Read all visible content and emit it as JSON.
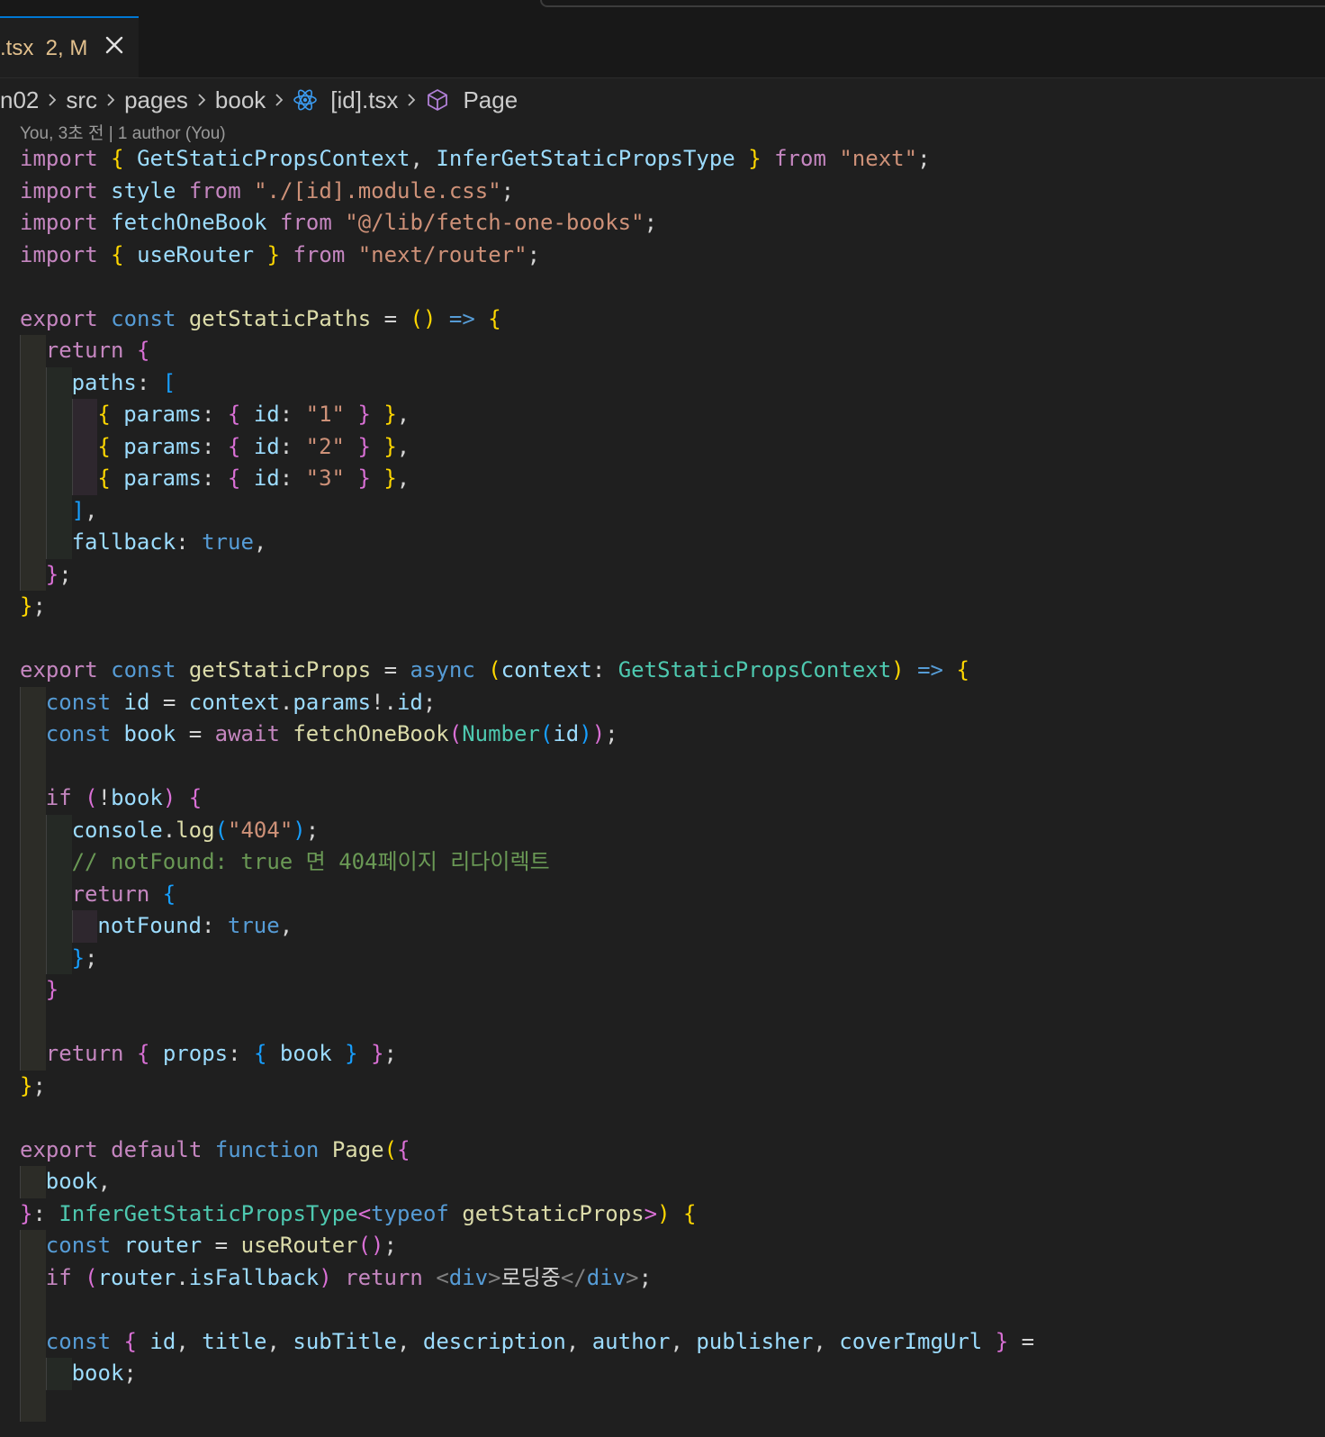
{
  "tab": {
    "label": ".tsx  2, M"
  },
  "breadcrumb": {
    "items": [
      "n02",
      "src",
      "pages",
      "book",
      "[id].tsx",
      "Page"
    ]
  },
  "blame": {
    "text": "You, 3초 전 | 1 author (You)"
  },
  "colors": {
    "keyword": "#c586c0",
    "string": "#ce9178",
    "storage": "#569cd6",
    "variable": "#9cdcfe",
    "function": "#dcdcaa",
    "type": "#4ec9b0",
    "comment": "#6a9955",
    "bracket1": "#ffd700",
    "bracket2": "#da70d6",
    "bracket3": "#179fff",
    "accent": "#0078d4"
  },
  "code": {
    "lines": [
      {
        "indent": 0,
        "tokens": [
          [
            "import",
            "k"
          ],
          [
            " ",
            "w"
          ],
          [
            "{",
            "y"
          ],
          [
            " ",
            "w"
          ],
          [
            "GetStaticPropsContext",
            "v"
          ],
          [
            ", ",
            "w"
          ],
          [
            "InferGetStaticPropsType",
            "v"
          ],
          [
            " ",
            "w"
          ],
          [
            "}",
            "y"
          ],
          [
            " ",
            "w"
          ],
          [
            "from",
            "k"
          ],
          [
            " ",
            "w"
          ],
          [
            "\"next\"",
            "s"
          ],
          [
            ";",
            "w"
          ]
        ]
      },
      {
        "indent": 0,
        "tokens": [
          [
            "import",
            "k"
          ],
          [
            " ",
            "w"
          ],
          [
            "style",
            "v"
          ],
          [
            " ",
            "w"
          ],
          [
            "from",
            "k"
          ],
          [
            " ",
            "w"
          ],
          [
            "\"./[id].module.css\"",
            "s"
          ],
          [
            ";",
            "w"
          ]
        ]
      },
      {
        "indent": 0,
        "tokens": [
          [
            "import",
            "k"
          ],
          [
            " ",
            "w"
          ],
          [
            "fetchOneBook",
            "v"
          ],
          [
            " ",
            "w"
          ],
          [
            "from",
            "k"
          ],
          [
            " ",
            "w"
          ],
          [
            "\"@/lib/fetch-one-books\"",
            "s"
          ],
          [
            ";",
            "w"
          ]
        ]
      },
      {
        "indent": 0,
        "tokens": [
          [
            "import",
            "k"
          ],
          [
            " ",
            "w"
          ],
          [
            "{",
            "y"
          ],
          [
            " ",
            "w"
          ],
          [
            "useRouter",
            "v"
          ],
          [
            " ",
            "w"
          ],
          [
            "}",
            "y"
          ],
          [
            " ",
            "w"
          ],
          [
            "from",
            "k"
          ],
          [
            " ",
            "w"
          ],
          [
            "\"next/router\"",
            "s"
          ],
          [
            ";",
            "w"
          ]
        ]
      },
      {
        "indent": 0,
        "tokens": []
      },
      {
        "indent": 0,
        "tokens": [
          [
            "export",
            "k"
          ],
          [
            " ",
            "w"
          ],
          [
            "const",
            "b"
          ],
          [
            " ",
            "w"
          ],
          [
            "getStaticPaths",
            "f"
          ],
          [
            " = ",
            "w"
          ],
          [
            "()",
            "y"
          ],
          [
            " ",
            "w"
          ],
          [
            "=>",
            "b"
          ],
          [
            " ",
            "w"
          ],
          [
            "{",
            "y"
          ]
        ]
      },
      {
        "indent": 1,
        "tokens": [
          [
            "return",
            "k"
          ],
          [
            " ",
            "w"
          ],
          [
            "{",
            "p"
          ]
        ]
      },
      {
        "indent": 2,
        "tokens": [
          [
            "paths",
            "v"
          ],
          [
            ": ",
            "w"
          ],
          [
            "[",
            "l"
          ]
        ]
      },
      {
        "indent": 3,
        "tokens": [
          [
            "{",
            "y"
          ],
          [
            " ",
            "w"
          ],
          [
            "params",
            "v"
          ],
          [
            ": ",
            "w"
          ],
          [
            "{",
            "p"
          ],
          [
            " ",
            "w"
          ],
          [
            "id",
            "v"
          ],
          [
            ": ",
            "w"
          ],
          [
            "\"1\"",
            "s"
          ],
          [
            " ",
            "w"
          ],
          [
            "}",
            "p"
          ],
          [
            " ",
            "w"
          ],
          [
            "}",
            "y"
          ],
          [
            ",",
            "w"
          ]
        ]
      },
      {
        "indent": 3,
        "tokens": [
          [
            "{",
            "y"
          ],
          [
            " ",
            "w"
          ],
          [
            "params",
            "v"
          ],
          [
            ": ",
            "w"
          ],
          [
            "{",
            "p"
          ],
          [
            " ",
            "w"
          ],
          [
            "id",
            "v"
          ],
          [
            ": ",
            "w"
          ],
          [
            "\"2\"",
            "s"
          ],
          [
            " ",
            "w"
          ],
          [
            "}",
            "p"
          ],
          [
            " ",
            "w"
          ],
          [
            "}",
            "y"
          ],
          [
            ",",
            "w"
          ]
        ]
      },
      {
        "indent": 3,
        "tokens": [
          [
            "{",
            "y"
          ],
          [
            " ",
            "w"
          ],
          [
            "params",
            "v"
          ],
          [
            ": ",
            "w"
          ],
          [
            "{",
            "p"
          ],
          [
            " ",
            "w"
          ],
          [
            "id",
            "v"
          ],
          [
            ": ",
            "w"
          ],
          [
            "\"3\"",
            "s"
          ],
          [
            " ",
            "w"
          ],
          [
            "}",
            "p"
          ],
          [
            " ",
            "w"
          ],
          [
            "}",
            "y"
          ],
          [
            ",",
            "w"
          ]
        ]
      },
      {
        "indent": 2,
        "tokens": [
          [
            "]",
            "l"
          ],
          [
            ",",
            "w"
          ]
        ]
      },
      {
        "indent": 2,
        "tokens": [
          [
            "fallback",
            "v"
          ],
          [
            ": ",
            "w"
          ],
          [
            "true",
            "b"
          ],
          [
            ",",
            "w"
          ]
        ]
      },
      {
        "indent": 1,
        "tokens": [
          [
            "}",
            "p"
          ],
          [
            ";",
            "w"
          ]
        ]
      },
      {
        "indent": 0,
        "tokens": [
          [
            "}",
            "y"
          ],
          [
            ";",
            "w"
          ]
        ]
      },
      {
        "indent": 0,
        "tokens": []
      },
      {
        "indent": 0,
        "tokens": [
          [
            "export",
            "k"
          ],
          [
            " ",
            "w"
          ],
          [
            "const",
            "b"
          ],
          [
            " ",
            "w"
          ],
          [
            "getStaticProps",
            "f"
          ],
          [
            " = ",
            "w"
          ],
          [
            "async",
            "b"
          ],
          [
            " ",
            "w"
          ],
          [
            "(",
            "y"
          ],
          [
            "context",
            "v"
          ],
          [
            ": ",
            "w"
          ],
          [
            "GetStaticPropsContext",
            "t"
          ],
          [
            ")",
            "y"
          ],
          [
            " ",
            "w"
          ],
          [
            "=>",
            "b"
          ],
          [
            " ",
            "w"
          ],
          [
            "{",
            "y"
          ]
        ]
      },
      {
        "indent": 1,
        "tokens": [
          [
            "const",
            "b"
          ],
          [
            " ",
            "w"
          ],
          [
            "id",
            "v"
          ],
          [
            " = ",
            "w"
          ],
          [
            "context",
            "v"
          ],
          [
            ".",
            "w"
          ],
          [
            "params",
            "v"
          ],
          [
            "!.",
            "w"
          ],
          [
            "id",
            "v"
          ],
          [
            ";",
            "w"
          ]
        ]
      },
      {
        "indent": 1,
        "tokens": [
          [
            "const",
            "b"
          ],
          [
            " ",
            "w"
          ],
          [
            "book",
            "v"
          ],
          [
            " = ",
            "w"
          ],
          [
            "await",
            "k"
          ],
          [
            " ",
            "w"
          ],
          [
            "fetchOneBook",
            "f"
          ],
          [
            "(",
            "p"
          ],
          [
            "Number",
            "t"
          ],
          [
            "(",
            "l"
          ],
          [
            "id",
            "v"
          ],
          [
            ")",
            "l"
          ],
          [
            ")",
            "p"
          ],
          [
            ";",
            "w"
          ]
        ]
      },
      {
        "indent": 1,
        "tokens": []
      },
      {
        "indent": 1,
        "tokens": [
          [
            "if",
            "k"
          ],
          [
            " ",
            "w"
          ],
          [
            "(",
            "p"
          ],
          [
            "!",
            "w"
          ],
          [
            "book",
            "v"
          ],
          [
            ")",
            "p"
          ],
          [
            " ",
            "w"
          ],
          [
            "{",
            "p"
          ]
        ]
      },
      {
        "indent": 2,
        "tokens": [
          [
            "console",
            "v"
          ],
          [
            ".",
            "w"
          ],
          [
            "log",
            "f"
          ],
          [
            "(",
            "l"
          ],
          [
            "\"404\"",
            "s"
          ],
          [
            ")",
            "l"
          ],
          [
            ";",
            "w"
          ]
        ]
      },
      {
        "indent": 2,
        "tokens": [
          [
            "// notFound: true 면 404페이지 리다이렉트",
            "c"
          ]
        ]
      },
      {
        "indent": 2,
        "tokens": [
          [
            "return",
            "k"
          ],
          [
            " ",
            "w"
          ],
          [
            "{",
            "l"
          ]
        ]
      },
      {
        "indent": 3,
        "tokens": [
          [
            "notFound",
            "v"
          ],
          [
            ": ",
            "w"
          ],
          [
            "true",
            "b"
          ],
          [
            ",",
            "w"
          ]
        ]
      },
      {
        "indent": 2,
        "tokens": [
          [
            "}",
            "l"
          ],
          [
            ";",
            "w"
          ]
        ]
      },
      {
        "indent": 1,
        "tokens": [
          [
            "}",
            "p"
          ]
        ]
      },
      {
        "indent": 1,
        "tokens": []
      },
      {
        "indent": 1,
        "tokens": [
          [
            "return",
            "k"
          ],
          [
            " ",
            "w"
          ],
          [
            "{",
            "p"
          ],
          [
            " ",
            "w"
          ],
          [
            "props",
            "v"
          ],
          [
            ": ",
            "w"
          ],
          [
            "{",
            "l"
          ],
          [
            " ",
            "w"
          ],
          [
            "book",
            "v"
          ],
          [
            " ",
            "w"
          ],
          [
            "}",
            "l"
          ],
          [
            " ",
            "w"
          ],
          [
            "}",
            "p"
          ],
          [
            ";",
            "w"
          ]
        ]
      },
      {
        "indent": 0,
        "tokens": [
          [
            "}",
            "y"
          ],
          [
            ";",
            "w"
          ]
        ]
      },
      {
        "indent": 0,
        "tokens": []
      },
      {
        "indent": 0,
        "tokens": [
          [
            "export",
            "k"
          ],
          [
            " ",
            "w"
          ],
          [
            "default",
            "k"
          ],
          [
            " ",
            "w"
          ],
          [
            "function",
            "b"
          ],
          [
            " ",
            "w"
          ],
          [
            "Page",
            "f"
          ],
          [
            "(",
            "y"
          ],
          [
            "{",
            "p"
          ]
        ]
      },
      {
        "indent": 1,
        "tokens": [
          [
            "book",
            "v"
          ],
          [
            ",",
            "w"
          ]
        ]
      },
      {
        "indent": 0,
        "tokens": [
          [
            "}",
            "p"
          ],
          [
            ": ",
            "w"
          ],
          [
            "InferGetStaticPropsType",
            "t"
          ],
          [
            "<",
            "p"
          ],
          [
            "typeof",
            "b"
          ],
          [
            " ",
            "w"
          ],
          [
            "getStaticProps",
            "f"
          ],
          [
            ">",
            "p"
          ],
          [
            ")",
            "y"
          ],
          [
            " ",
            "w"
          ],
          [
            "{",
            "y"
          ]
        ]
      },
      {
        "indent": 1,
        "tokens": [
          [
            "const",
            "b"
          ],
          [
            " ",
            "w"
          ],
          [
            "router",
            "v"
          ],
          [
            " = ",
            "w"
          ],
          [
            "useRouter",
            "f"
          ],
          [
            "()",
            "p"
          ],
          [
            ";",
            "w"
          ]
        ]
      },
      {
        "indent": 1,
        "tokens": [
          [
            "if",
            "k"
          ],
          [
            " ",
            "w"
          ],
          [
            "(",
            "p"
          ],
          [
            "router",
            "v"
          ],
          [
            ".",
            "w"
          ],
          [
            "isFallback",
            "v"
          ],
          [
            ")",
            "p"
          ],
          [
            " ",
            "w"
          ],
          [
            "return",
            "k"
          ],
          [
            " ",
            "w"
          ],
          [
            "<",
            "gr"
          ],
          [
            "div",
            "b"
          ],
          [
            ">",
            "gr"
          ],
          [
            "로딩중",
            "w"
          ],
          [
            "</",
            "gr"
          ],
          [
            "div",
            "b"
          ],
          [
            ">",
            "gr"
          ],
          [
            ";",
            "w"
          ]
        ]
      },
      {
        "indent": 1,
        "tokens": []
      },
      {
        "indent": 1,
        "tokens": [
          [
            "const",
            "b"
          ],
          [
            " ",
            "w"
          ],
          [
            "{",
            "p"
          ],
          [
            " ",
            "w"
          ],
          [
            "id",
            "v"
          ],
          [
            ", ",
            "w"
          ],
          [
            "title",
            "v"
          ],
          [
            ", ",
            "w"
          ],
          [
            "subTitle",
            "v"
          ],
          [
            ", ",
            "w"
          ],
          [
            "description",
            "v"
          ],
          [
            ", ",
            "w"
          ],
          [
            "author",
            "v"
          ],
          [
            ", ",
            "w"
          ],
          [
            "publisher",
            "v"
          ],
          [
            ", ",
            "w"
          ],
          [
            "coverImgUrl",
            "v"
          ],
          [
            " ",
            "w"
          ],
          [
            "}",
            "p"
          ],
          [
            " =",
            "w"
          ]
        ]
      },
      {
        "indent": 2,
        "tokens": [
          [
            "book",
            "v"
          ],
          [
            ";",
            "w"
          ]
        ]
      },
      {
        "indent": 1,
        "tokens": []
      }
    ]
  }
}
